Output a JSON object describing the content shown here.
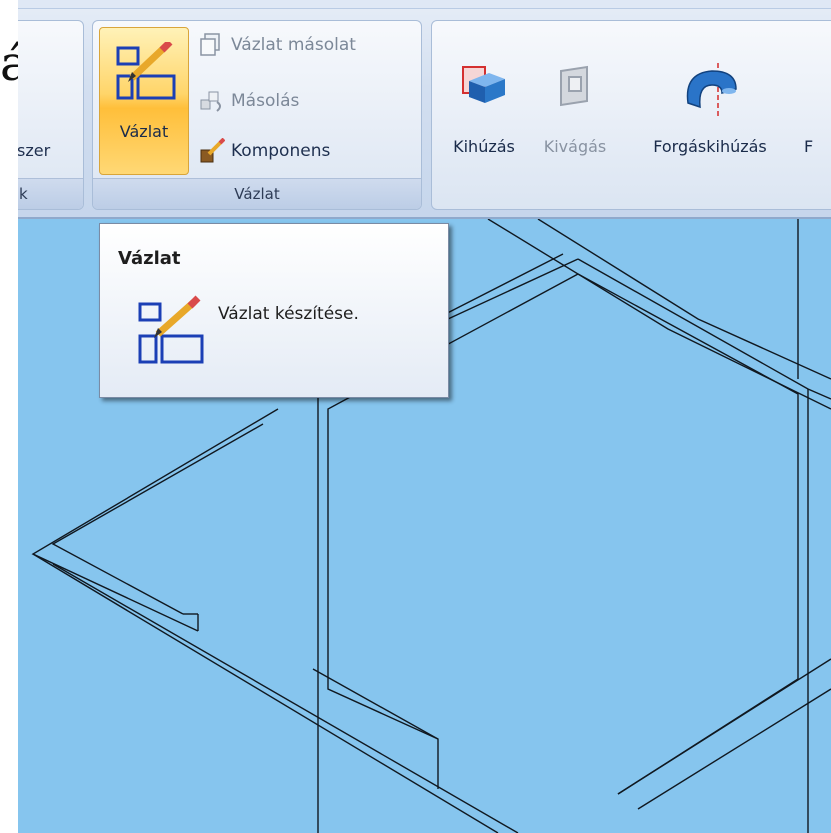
{
  "left_fragment": {
    "glyph": "á"
  },
  "ribbon": {
    "group_left": {
      "button_fragment": "szer",
      "label_fragment": "k"
    },
    "group_vazlat": {
      "big_button_label": "Vázlat",
      "small_buttons": [
        {
          "label": "Vázlat másolat",
          "enabled": false
        },
        {
          "label": "Másolás",
          "enabled": false
        },
        {
          "label": "Komponens",
          "enabled": true
        }
      ],
      "group_label": "Vázlat"
    },
    "group_features": {
      "buttons": [
        {
          "label": "Kihúzás",
          "enabled": true
        },
        {
          "label": "Kivágás",
          "enabled": false
        },
        {
          "label": "Forgáskihúzás",
          "enabled": true
        },
        {
          "label": "F",
          "enabled": true
        }
      ]
    }
  },
  "tooltip": {
    "title": "Vázlat",
    "description": "Vázlat készítése."
  },
  "colors": {
    "canvas": "#86c5ee",
    "highlight": "#ffc94a",
    "sketch_icon": "#1b3fb5"
  }
}
